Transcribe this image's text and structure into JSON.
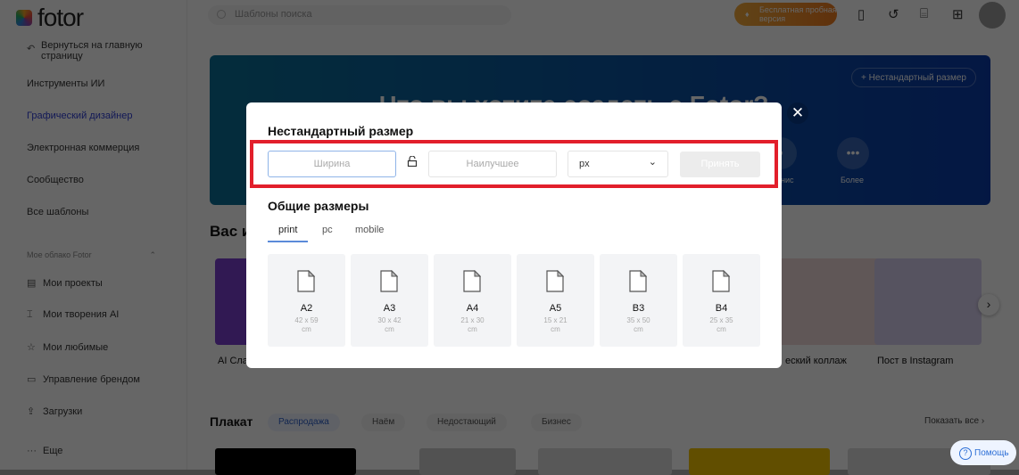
{
  "sidebar": {
    "logo": "fotor",
    "back": "Вернуться на главную страницу",
    "items": [
      "Инструменты ИИ",
      "Графический дизайнер",
      "Электронная коммерция",
      "Сообщество",
      "Все шаблоны"
    ],
    "cloud_title": "Мое облако Fotor",
    "cloud_items": [
      "Мои проекты",
      "Мои творения AI",
      "Мои любимые",
      "Управление брендом",
      "Загрузки",
      "Еще"
    ]
  },
  "header": {
    "search_placeholder": "Шаблоны поиска",
    "trial": "Бесплатная пробная версия"
  },
  "banner": {
    "title": "Что вы хотите создать с Fotor?",
    "custom_size": "Нестандартный размер",
    "more": "Более",
    "business_partial": "нис"
  },
  "recommend": {
    "title_partial": "Вас и",
    "labels": [
      "AI Сла",
      "еский коллаж",
      "Пост в Instagram"
    ]
  },
  "poster": {
    "title": "Плакат",
    "chips": [
      "Распродажа",
      "Наём",
      "Недостающий",
      "Бизнес"
    ],
    "show_all": "Показать все"
  },
  "help": "Помощь",
  "modal": {
    "title": "Нестандартный размер",
    "width_placeholder": "Ширина",
    "height_placeholder": "Наилучшее",
    "unit": "px",
    "apply": "Принять",
    "common_title": "Общие размеры",
    "tabs": [
      "print",
      "pc",
      "mobile"
    ],
    "sizes": [
      {
        "name": "A2",
        "dim": "42 x 59",
        "unit": "cm"
      },
      {
        "name": "A3",
        "dim": "30 x 42",
        "unit": "cm"
      },
      {
        "name": "A4",
        "dim": "21 x 30",
        "unit": "cm"
      },
      {
        "name": "A5",
        "dim": "15 x 21",
        "unit": "cm"
      },
      {
        "name": "B3",
        "dim": "35 x 50",
        "unit": "cm"
      },
      {
        "name": "B4",
        "dim": "25 x 35",
        "unit": "cm"
      }
    ]
  },
  "colors": {
    "accent": "#2d3dd6",
    "highlight": "#e21f2b",
    "trial": "#ee7b1e"
  }
}
